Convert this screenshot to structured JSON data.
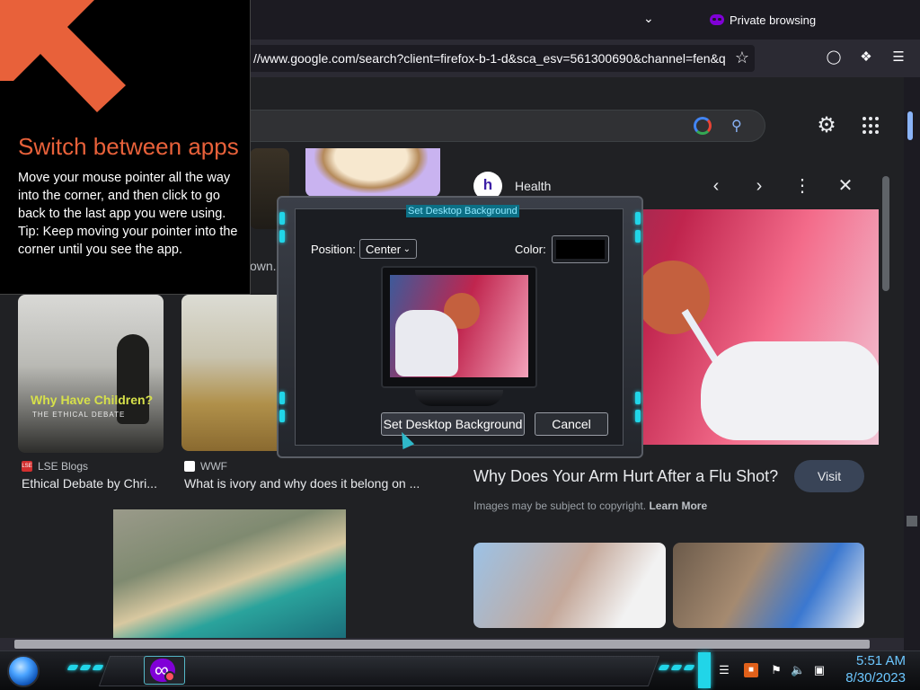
{
  "browser": {
    "private_label": "Private browsing",
    "url": "//www.google.com/search?client=firefox-b-1-d&sca_esv=561300690&channel=fen&q"
  },
  "google": {
    "lens_icon": "google-lens-icon",
    "search_icon": "magnifier-icon"
  },
  "results": {
    "bike_snippet": "own...",
    "card1": {
      "image_title": "Why Have Children?",
      "image_subtitle": "THE ETHICAL DEBATE",
      "source_icon": "LSE",
      "source": "LSE Blogs",
      "title": "Ethical Debate by Chri..."
    },
    "card2": {
      "source": "WWF",
      "title": "What is ivory and why does it belong on ..."
    }
  },
  "panel": {
    "logo_letter": "h",
    "source": "Health",
    "title": "Why Does Your Arm Hurt After a Flu Shot?",
    "visit_label": "Visit",
    "copyright": "Images may be subject to copyright.",
    "learn_more": "Learn More"
  },
  "switch_tip": {
    "title": "Switch between apps",
    "body": "Move your mouse pointer all the way into the corner, and then click to go back to the last app you were using.",
    "tip": "Tip: Keep moving your pointer into the corner until you see the app."
  },
  "dialog": {
    "caption": "Set Desktop Background",
    "position_label": "Position:",
    "position_value": "Center",
    "color_label": "Color:",
    "color_value": "#000000",
    "set_button": "Set Desktop Background",
    "cancel_button": "Cancel"
  },
  "taskbar": {
    "time": "5:51 AM",
    "date": "8/30/2023"
  },
  "colors": {
    "accent_cyan": "#21d5e8",
    "clock_blue": "#6cc7ff",
    "tip_orange": "#e8613a"
  }
}
